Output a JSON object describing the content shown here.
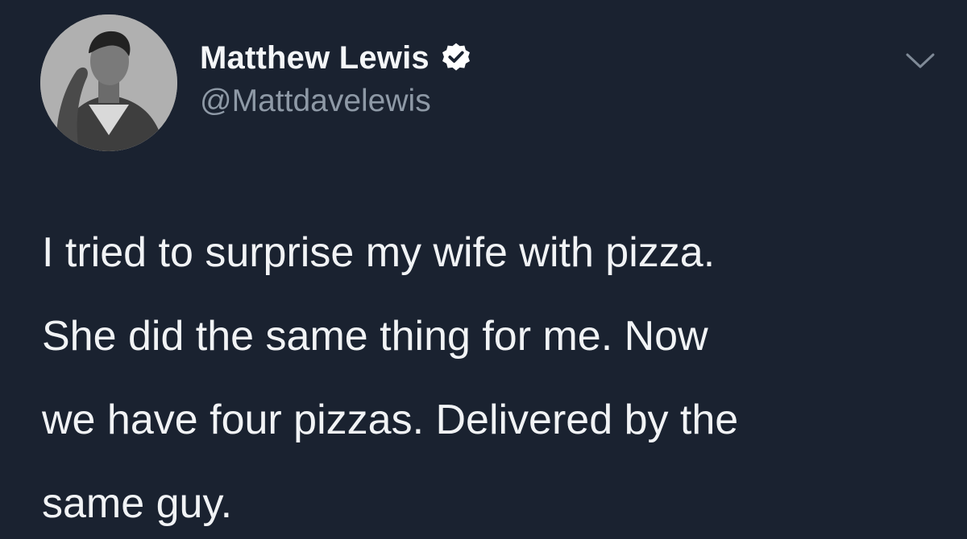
{
  "tweet": {
    "author": {
      "display_name": "Matthew Lewis",
      "handle": "@Mattdavelewis",
      "verified": true,
      "avatar_icon": "profile-photo"
    },
    "menu_icon": "chevron-down-icon",
    "text_lines": [
      "I tried to surprise my wife with pizza.",
      "She did the same thing for me. Now",
      "we have four pizzas. Delivered by the",
      "same guy."
    ]
  },
  "colors": {
    "background": "#1a2230",
    "name": "#f4f6f8",
    "handle": "#8e99a6",
    "text": "#f1f3f5",
    "verified_badge": "#ffffff"
  }
}
